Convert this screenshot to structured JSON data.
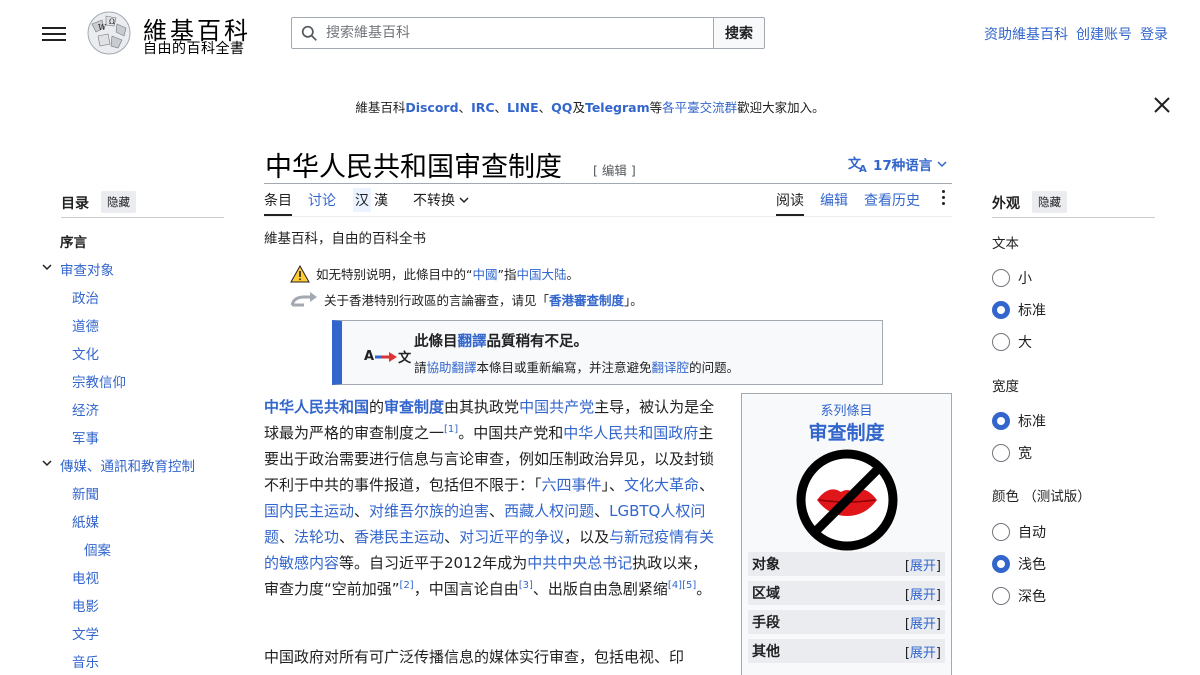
{
  "header": {
    "logo_word": "維基百科",
    "logo_tagline": "自由的百科全書",
    "search_placeholder": "搜索維基百科",
    "search_button": "搜索",
    "user_links": [
      "资助維基百科",
      "创建账号",
      "登录"
    ]
  },
  "banner": {
    "prefix": "維基百科",
    "channels": [
      "Discord",
      "IRC",
      "LINE",
      "QQ"
    ],
    "and": "及",
    "telegram": "Telegram",
    "mid": "等",
    "groups_link": "各平臺交流群",
    "suffix": "歡迎大家加入。"
  },
  "article": {
    "title": "中华人民共和国审查制度",
    "edit_label": "[ 编辑 ]",
    "languages": "17种语言",
    "tabs_left": [
      "条目",
      "讨论"
    ],
    "variant_selected": "汉",
    "variant_other": "漢",
    "variant_conversion": "不转换",
    "tabs_right": [
      "阅读",
      "编辑",
      "查看历史"
    ],
    "site_sub": "維基百科，自由的百科全书",
    "note1": {
      "text1": "如无特别说明，此條目中的“",
      "link1": "中國",
      "text2": "”指",
      "link2": "中国大陆",
      "text3": "。"
    },
    "note2": {
      "text1": "关于香港特别行政區的言論審查，请见「",
      "link": "香港審查制度",
      "text2": "」。"
    },
    "ambox": {
      "icon_a": "A",
      "icon_b": "文",
      "line1_pre": "此條目",
      "line1_link": "翻譯",
      "line1_post": "品質稍有不足。",
      "line2_pre": "請",
      "line2_link1": "協助翻譯",
      "line2_mid": "本條目或重新編寫，并注意避免",
      "line2_link2": "翻译腔",
      "line2_post": "的问题。"
    },
    "para1": {
      "b1": "中华人民共和国",
      "t1": "的",
      "b2": "审查制度",
      "t2": "由其执政党",
      "l1": "中国共产党",
      "t3": "主导，被认为是全球最为严格的审查制度之一",
      "r1": "[1]",
      "t4": "。中国共产党和",
      "l2": "中华人民共和国政府",
      "t5": "主要出于政治需要进行信息与言论审查，例如压制政治异见，以及封锁不利于中共的事件报道，包括但不限于：「",
      "l3": "六四事件",
      "t6": "」、",
      "l4": "文化大革命",
      "s1": "、",
      "l5": "国内民主运动",
      "s2": "、",
      "l6": "对维吾尔族的迫害",
      "s3": "、",
      "l7": "西藏人权问题",
      "s4": "、",
      "l8": "LGBTQ人权问题",
      "s5": "、",
      "l9": "法轮功",
      "s6": "、",
      "l10": "香港民主运动",
      "s7": "、",
      "l11": "对习近平的争议",
      "t7": "，以及",
      "l12": "与新冠疫情有关的敏感内容",
      "t8": "等。自习近平于2012年成为",
      "l13": "中共中央总书记",
      "t9": "执政以来，审查力度“空前加强”",
      "r2": "[2]",
      "t10": "，中国言论自由",
      "r3": "[3]",
      "t11": "、出版自由急剧紧缩",
      "r4": "[4]",
      "r5": "[5]",
      "t12": "。"
    },
    "para2": "中国政府对所有可广泛传播信息的媒体实行审查，包括电视、印"
  },
  "infobox": {
    "series": "系列條目",
    "title": "审查制度",
    "rows": [
      {
        "label": "对象",
        "action": "展开"
      },
      {
        "label": "区域",
        "action": "展开"
      },
      {
        "label": "手段",
        "action": "展开"
      },
      {
        "label": "其他",
        "action": "展开"
      }
    ]
  },
  "toc": {
    "heading": "目录",
    "hide": "隐藏",
    "items": [
      {
        "label": "序言",
        "level": 0
      },
      {
        "label": "审查对象",
        "level": 0,
        "expandable": true
      },
      {
        "label": "政治",
        "level": 1
      },
      {
        "label": "道德",
        "level": 1
      },
      {
        "label": "文化",
        "level": 1
      },
      {
        "label": "宗教信仰",
        "level": 1
      },
      {
        "label": "经济",
        "level": 1
      },
      {
        "label": "军事",
        "level": 1
      },
      {
        "label": "傳媒、通訊和教育控制",
        "level": 0,
        "expandable": true
      },
      {
        "label": "新聞",
        "level": 1
      },
      {
        "label": "紙媒",
        "level": 1
      },
      {
        "label": "個案",
        "level": 2
      },
      {
        "label": "电视",
        "level": 1
      },
      {
        "label": "电影",
        "level": 1
      },
      {
        "label": "文学",
        "level": 1
      },
      {
        "label": "音乐",
        "level": 1
      }
    ]
  },
  "appearance": {
    "heading": "外观",
    "hide": "隐藏",
    "text_label": "文本",
    "text_options": [
      {
        "label": "小",
        "selected": false
      },
      {
        "label": "标准",
        "selected": true
      },
      {
        "label": "大",
        "selected": false
      }
    ],
    "width_label": "宽度",
    "width_options": [
      {
        "label": "标准",
        "selected": true
      },
      {
        "label": "宽",
        "selected": false
      }
    ],
    "color_label": "颜色 （测试版）",
    "color_options": [
      {
        "label": "自动",
        "selected": false
      },
      {
        "label": "浅色",
        "selected": true
      },
      {
        "label": "深色",
        "selected": false
      }
    ]
  },
  "colors": {
    "link": "#3366cc",
    "text": "#202122",
    "border": "#a2a9b1",
    "accent": "#3366cc"
  }
}
